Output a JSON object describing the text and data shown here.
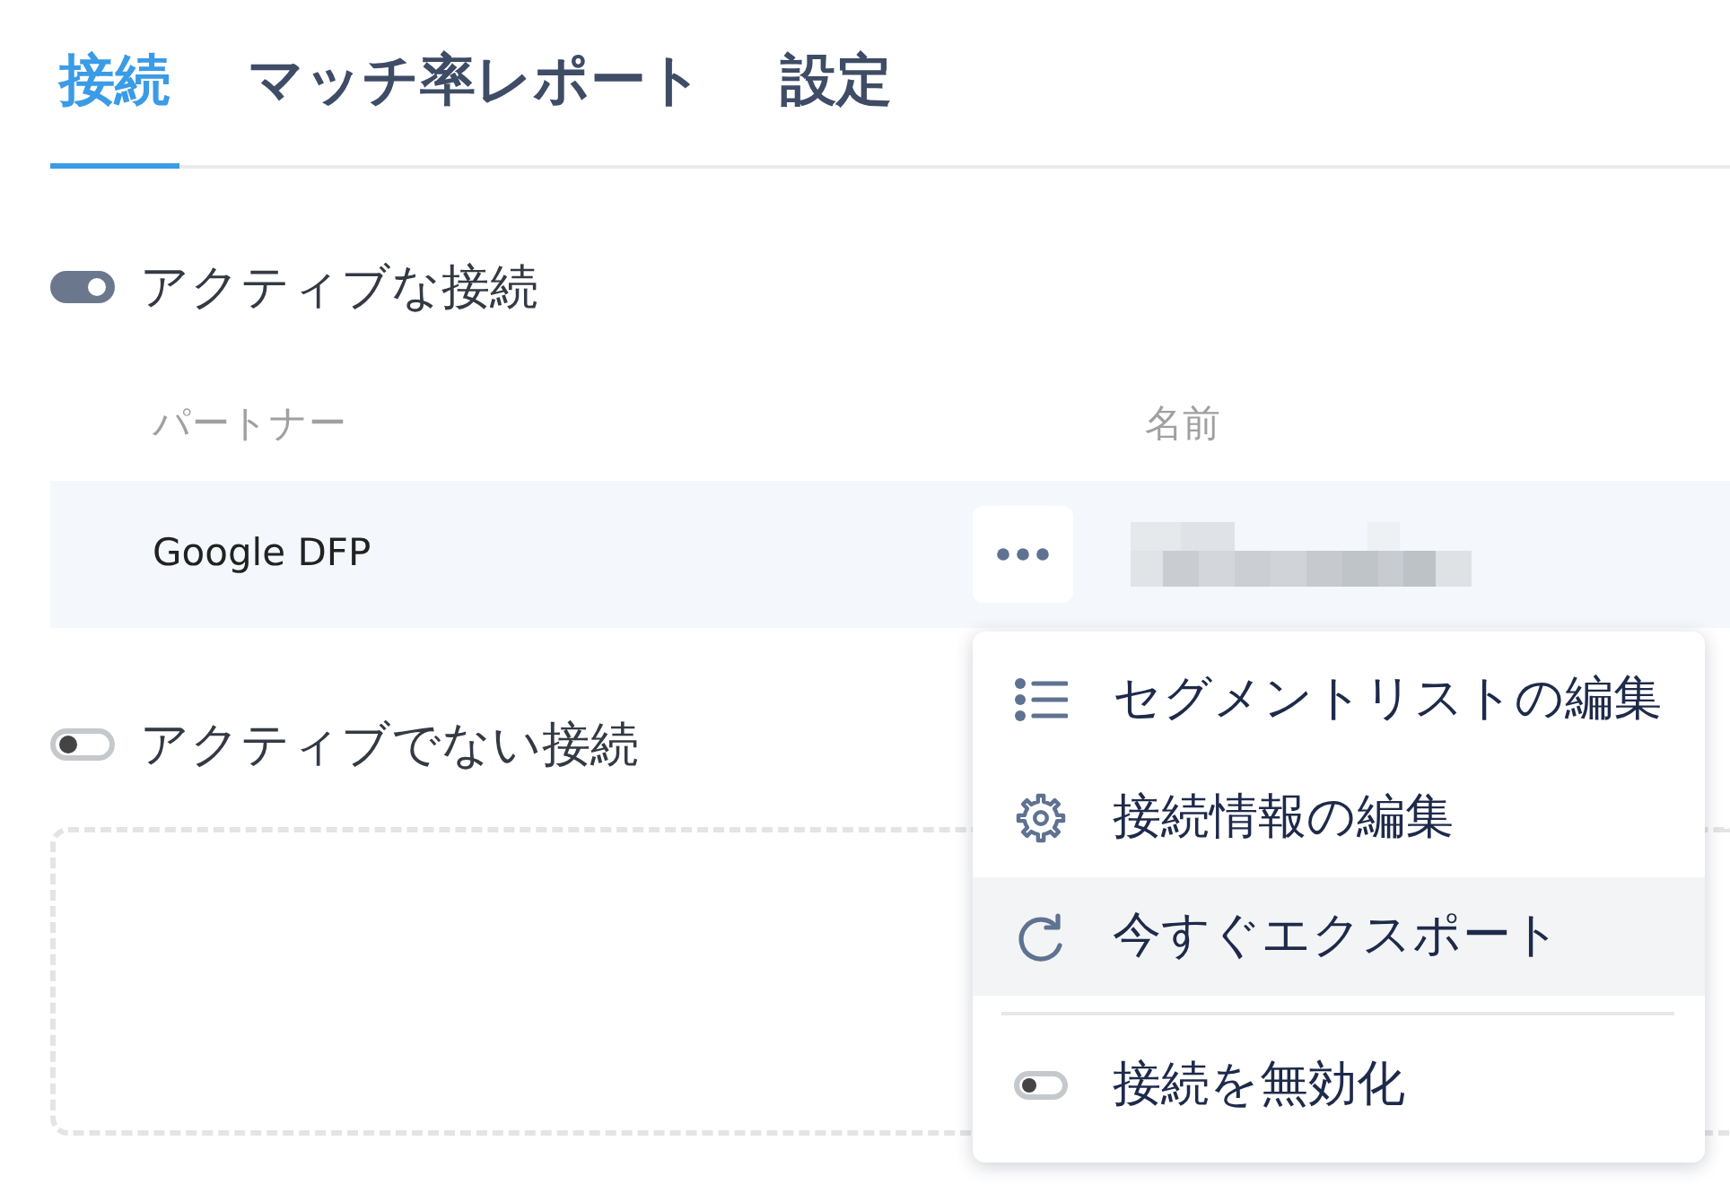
{
  "tabs": [
    {
      "label": "接続",
      "selected": true
    },
    {
      "label": "マッチ率レポート",
      "selected": false
    },
    {
      "label": "設定",
      "selected": false
    }
  ],
  "sections": [
    {
      "title": "アクティブな接続",
      "on": true,
      "table": {
        "columns": [
          "パートナー",
          "名前"
        ],
        "rows": [
          {
            "partner": "Google DFP"
          }
        ]
      }
    },
    {
      "title": "アクティブでない接続",
      "on": false
    }
  ],
  "row_menu": {
    "groups": [
      {
        "items": [
          {
            "label": "セグメントリストの編集",
            "highlighted": false
          },
          {
            "label": "接続情報の編集",
            "highlighted": false
          },
          {
            "label": "今すぐエクスポート",
            "highlighted": true
          }
        ]
      },
      {
        "items": [
          {
            "label": "接続を無効化",
            "highlighted": false
          }
        ]
      }
    ]
  }
}
